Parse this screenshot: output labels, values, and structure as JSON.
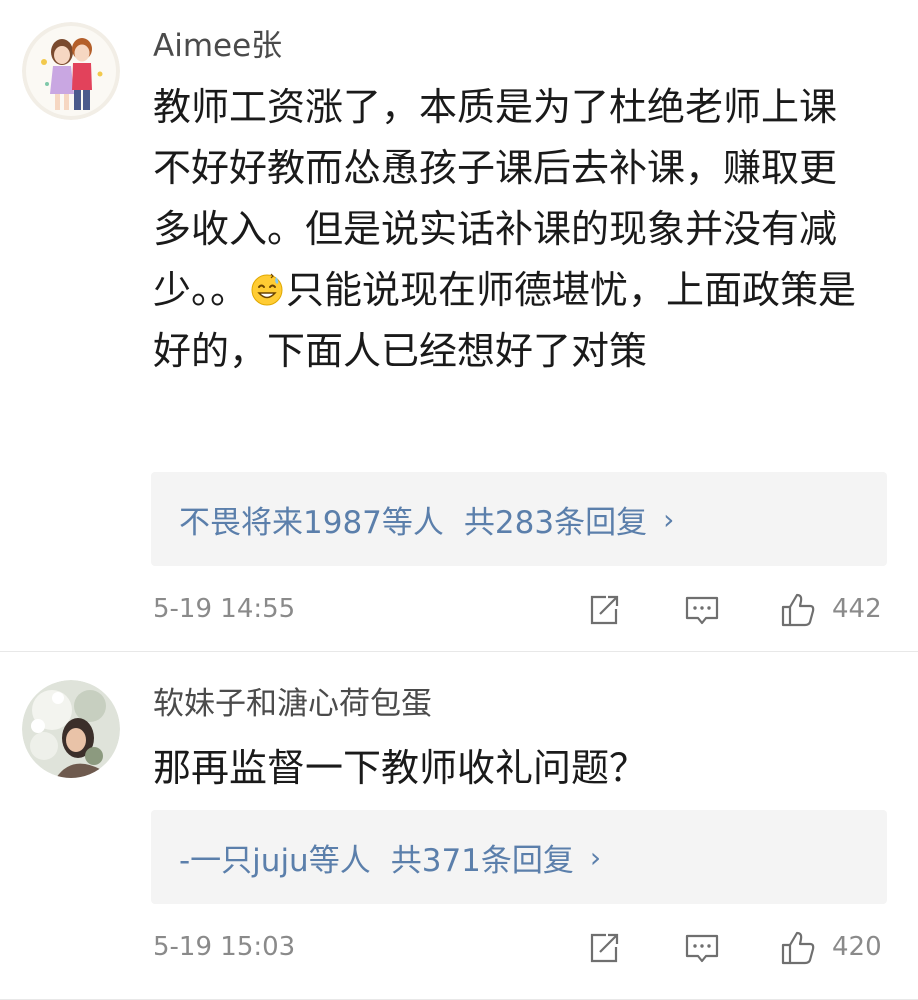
{
  "comments": [
    {
      "username": "Aimee张",
      "text_part1": "教师工资涨了，本质是为了杜绝老师上课不好好教而怂恿孩子课后去补课，赚取更多收入。但是说实话补课的现象并没有减少。。",
      "emoji": "sweat-smile-emoji",
      "text_part2": "只能说现在师德堪忧，上面政策是好的，下面人已经想好了对策",
      "replies_users": "不畏将来1987等人",
      "replies_total": "共283条回复",
      "timestamp": "5-19 14:55",
      "likes": "442"
    },
    {
      "username": "软妹子和溏心荷包蛋",
      "text": "那再监督一下教师收礼问题？",
      "replies_users": "-一只juju等人",
      "replies_total": "共371条回复",
      "timestamp": "5-19 15:03",
      "likes": "420"
    }
  ],
  "ui": {
    "chevron": "›",
    "accent": "#5b7fab",
    "meta_color": "#8a8a8a",
    "reply_bg": "#f4f4f4"
  },
  "icons": {
    "share": "share-icon",
    "reply": "comment-icon",
    "like": "thumbs-up-icon"
  }
}
